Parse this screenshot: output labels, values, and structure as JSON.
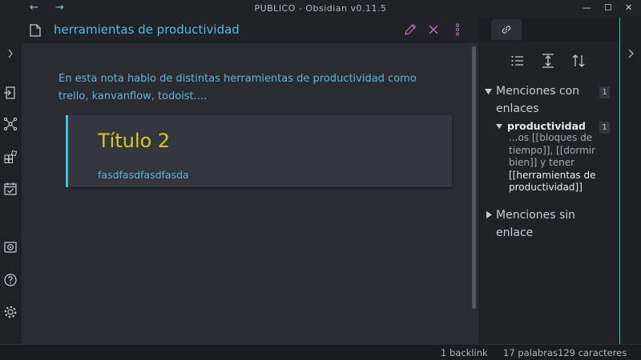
{
  "window": {
    "title": "PUBLICO - Obsidian v0.11.5",
    "back_label": "←",
    "forward_label": "→",
    "minimize_label": "—",
    "maximize_label": "☐",
    "close_label": "✕"
  },
  "left_ribbon": {
    "icons": [
      "open-note-icon",
      "graph-view-icon",
      "templates-icon",
      "daily-note-icon",
      "vault-icon",
      "help-icon",
      "settings-icon"
    ]
  },
  "editor": {
    "note_title": "herramientas de productividad",
    "paragraph": "En esta nota hablo de distintas herramientas de productividad como trello, kanvanflow, todoist....",
    "callout_heading": "Título 2",
    "callout_text": "fasdfasdfasdfasda",
    "colors": {
      "title": "#58b7e8",
      "heading": "#d4c926",
      "text": "#5db4d8",
      "accent": "#42c3dc",
      "action": "#c06fcf"
    }
  },
  "backlinks": {
    "linked_label": "Menciones con enlaces",
    "linked_count": "1",
    "file_name": "productividad",
    "file_count": "1",
    "snippet_pre": "...os [[bloques de tiempo]], [[dormir bien]] y tener",
    "snippet_match": "[[herramientas de productividad]]",
    "unlinked_label": "Menciones sin enlace"
  },
  "statusbar": {
    "backlinks": "1 backlink",
    "words": "17 palabras",
    "chars": "129 caracteres"
  }
}
